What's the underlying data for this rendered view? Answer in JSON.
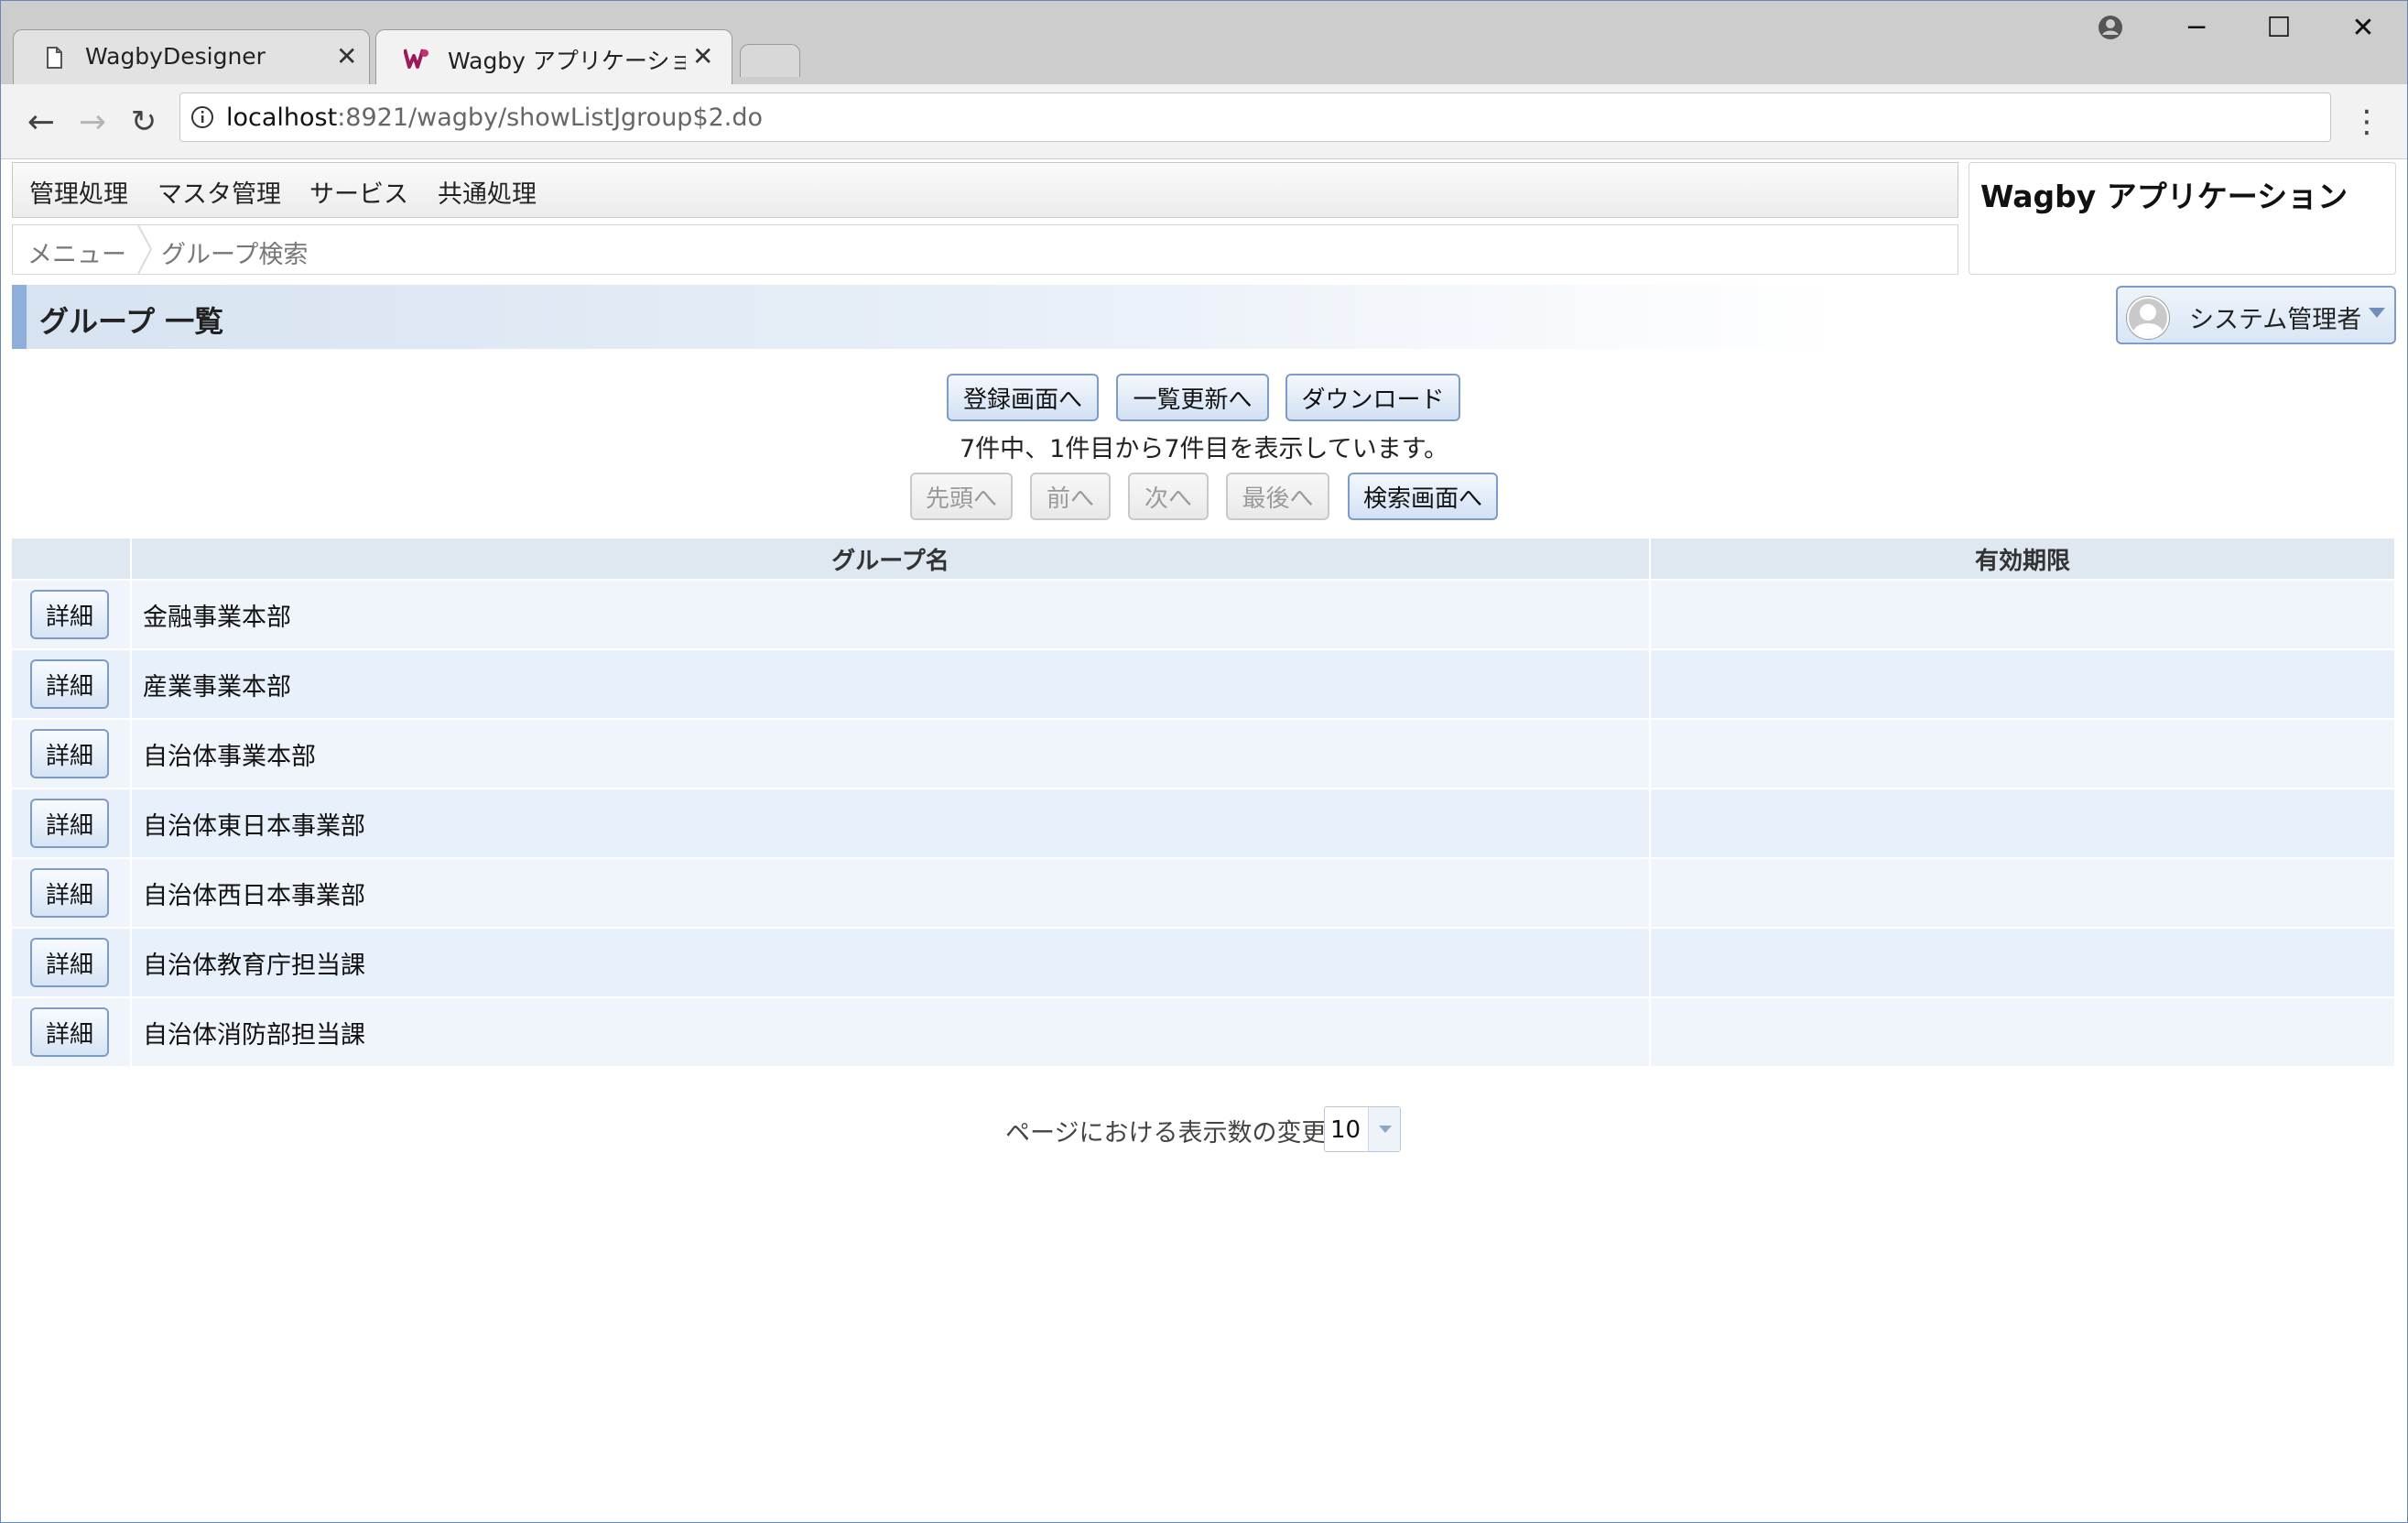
{
  "browser": {
    "tabs": [
      {
        "title": "WagbyDesigner",
        "icon": "document-icon",
        "active": false
      },
      {
        "title": "Wagby アプリケーション グル",
        "icon": "wagby-logo-icon",
        "active": true
      }
    ],
    "url_host": "localhost",
    "url_path": ":8921/wagby/showListJgroup$2.do",
    "nav_icons": [
      "back-arrow-icon",
      "forward-arrow-icon",
      "reload-icon",
      "info-icon",
      "star-icon",
      "more-icon"
    ],
    "window_controls": [
      "profile-icon",
      "minimize-icon",
      "maximize-icon",
      "close-icon"
    ]
  },
  "menu": {
    "items": [
      "管理処理",
      "マスタ管理",
      "サービス",
      "共通処理"
    ]
  },
  "breadcrumb": {
    "items": [
      "メニュー",
      "グループ検索"
    ]
  },
  "app": {
    "title": "Wagby アプリケーション"
  },
  "header": {
    "title": "グループ 一覧",
    "user_label": "システム管理者"
  },
  "actions": {
    "register": "登録画面へ",
    "refresh": "一覧更新へ",
    "download": "ダウンロード"
  },
  "result_info": "7件中、1件目から7件目を表示しています。",
  "pager": {
    "first": "先頭へ",
    "prev": "前へ",
    "next": "次へ",
    "last": "最後へ",
    "search": "検索画面へ"
  },
  "table": {
    "columns": [
      "",
      "グループ名",
      "有効期限"
    ],
    "detail_label": "詳細",
    "rows": [
      {
        "name": "金融事業本部",
        "expiry": ""
      },
      {
        "name": "産業事業本部",
        "expiry": ""
      },
      {
        "name": "自治体事業本部",
        "expiry": ""
      },
      {
        "name": "自治体東日本事業部",
        "expiry": ""
      },
      {
        "name": "自治体西日本事業部",
        "expiry": ""
      },
      {
        "name": "自治体教育庁担当課",
        "expiry": ""
      },
      {
        "name": "自治体消防部担当課",
        "expiry": ""
      }
    ]
  },
  "page_size": {
    "label": "ページにおける表示数の変更",
    "value": "10"
  },
  "colors": {
    "accent": "#8eaedb",
    "button_border": "#7d9cc7",
    "row_odd": "#f0f5fb",
    "row_even": "#e8f1fb",
    "header_bg": "#dfe7f1"
  }
}
